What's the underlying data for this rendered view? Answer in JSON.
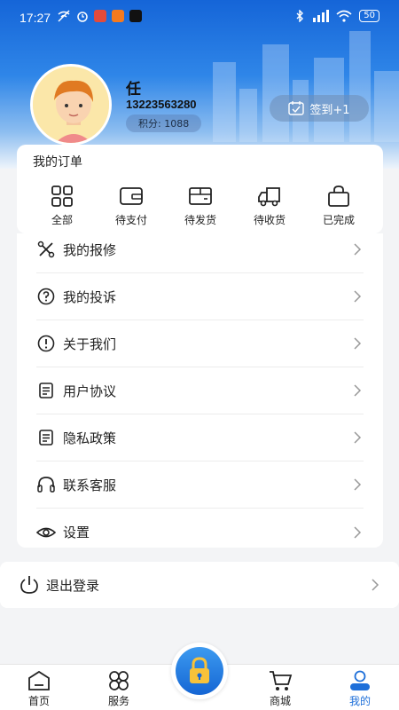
{
  "status_bar": {
    "time": "17:27",
    "battery": "50",
    "left_icons": [
      "wifi-off-icon",
      "alarm-icon",
      "app-badge-icon",
      "taobao-icon",
      "tiktok-icon"
    ],
    "right_icons": [
      "bluetooth-icon",
      "signal-icon",
      "wifi-icon",
      "battery-icon"
    ]
  },
  "profile": {
    "name": "任",
    "phone": "13223563280",
    "points_label": "积分: 1088",
    "checkin_label": "签到+1"
  },
  "orders": {
    "title": "我的订单",
    "items": [
      {
        "label": "全部",
        "icon": "grid-icon"
      },
      {
        "label": "待支付",
        "icon": "wallet-icon"
      },
      {
        "label": "待发货",
        "icon": "box-icon"
      },
      {
        "label": "待收货",
        "icon": "truck-icon"
      },
      {
        "label": "已完成",
        "icon": "bag-icon"
      }
    ]
  },
  "menu": {
    "items": [
      {
        "label": "我的报修",
        "icon": "tools-icon"
      },
      {
        "label": "我的投诉",
        "icon": "question-icon"
      },
      {
        "label": "关于我们",
        "icon": "info-icon"
      },
      {
        "label": "用户协议",
        "icon": "document-icon"
      },
      {
        "label": "隐私政策",
        "icon": "document-icon"
      },
      {
        "label": "联系客服",
        "icon": "headset-icon"
      },
      {
        "label": "设置",
        "icon": "eye-icon"
      }
    ]
  },
  "logout": {
    "label": "退出登录",
    "icon": "power-icon"
  },
  "tabbar": {
    "items": [
      {
        "label": "首页",
        "icon": "home-icon"
      },
      {
        "label": "服务",
        "icon": "services-icon"
      },
      {
        "label": "商城",
        "icon": "cart-icon"
      },
      {
        "label": "我的",
        "icon": "user-icon"
      }
    ],
    "center_icon": "lock-icon",
    "active": "我的"
  },
  "colors": {
    "accent": "#1e6fd9",
    "header": "#1565d8",
    "checkin_bg": "#6e8cb4"
  }
}
